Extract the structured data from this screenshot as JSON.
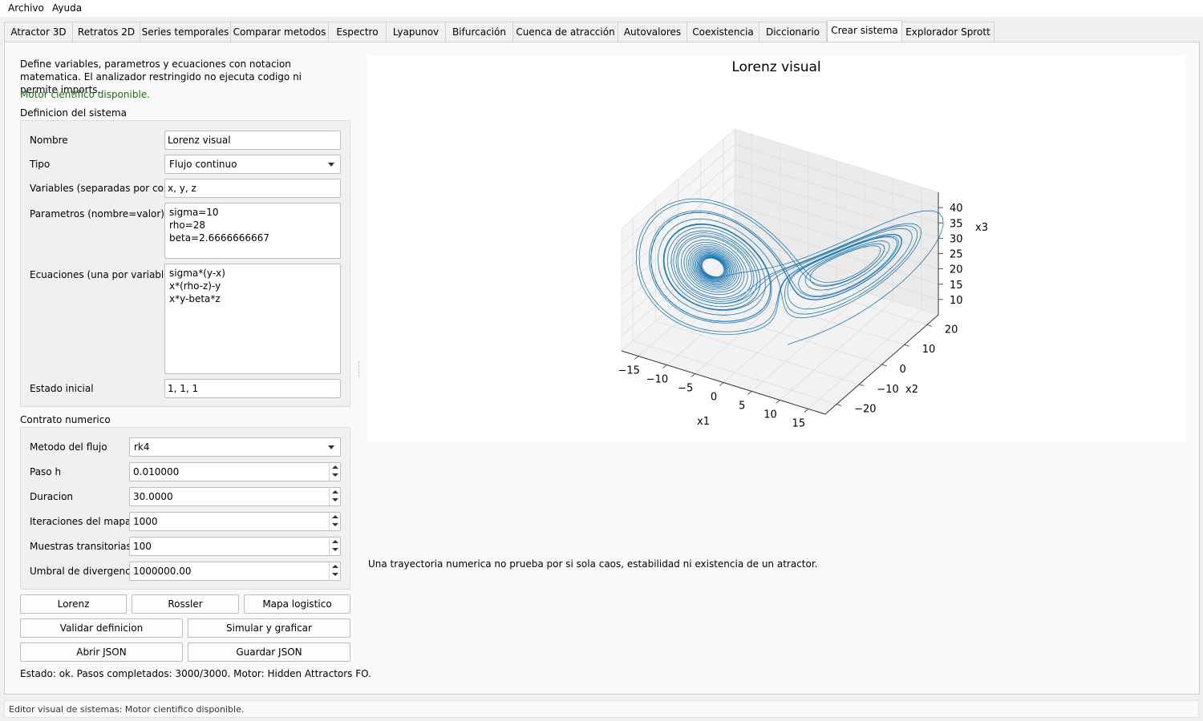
{
  "menu": [
    "Archivo",
    "Ayuda"
  ],
  "tabs": [
    "Atractor 3D",
    "Retratos 2D",
    "Series temporales",
    "Comparar metodos",
    "Espectro",
    "Lyapunov",
    "Bifurcación",
    "Cuenca de atracción",
    "Autovalores",
    "Coexistencia",
    "Diccionario",
    "Crear sistema",
    "Explorador Sprott"
  ],
  "active_tab": "Crear sistema",
  "intro": "Define variables, parametros y ecuaciones con notacion matematica. El analizador restringido no ejecuta codigo ni permite imports.",
  "motor_status": "Motor cientifico disponible.",
  "definition": {
    "section_title": "Definicion del sistema",
    "name_label": "Nombre",
    "name_value": "Lorenz visual",
    "type_label": "Tipo",
    "type_value": "Flujo continuo",
    "variables_label": "Variables (separadas por coma)",
    "variables_value": "x, y, z",
    "params_label": "Parametros (nombre=valor)",
    "params_lines": [
      "sigma=10",
      "rho=28",
      "beta=2.6666666667"
    ],
    "equations_label": "Ecuaciones (una por variable)",
    "equations_lines": [
      "sigma*(y-x)",
      "x*(rho-z)-y",
      "x*y-beta*z"
    ],
    "initial_label": "Estado inicial",
    "initial_value": "1, 1, 1"
  },
  "contract": {
    "section_title": "Contrato numerico",
    "method_label": "Metodo del flujo",
    "method_value": "rk4",
    "step_label": "Paso h",
    "step_value": "0.010000",
    "duration_label": "Duracion",
    "duration_value": "30.0000",
    "iterations_label": "Iteraciones del mapa",
    "iterations_value": "1000",
    "transient_label": "Muestras transitorias",
    "transient_value": "100",
    "threshold_label": "Umbral de divergencia",
    "threshold_value": "1000000.00"
  },
  "buttons": {
    "lorenz": "Lorenz",
    "rossler": "Rossler",
    "logistic": "Mapa logistico",
    "validate": "Validar definicion",
    "simulate": "Simular y graficar",
    "open_json": "Abrir JSON",
    "save_json": "Guardar JSON"
  },
  "run_status": "Estado: ok. Pasos completados: 3000/3000. Motor: Hidden Attractors FO.",
  "note": "Una trayectoria numerica no prueba por si sola caos, estabilidad ni existencia de un atractor.",
  "statusbar": "Editor visual de sistemas: Motor cientifico disponible.",
  "chart_data": {
    "type": "line",
    "projection": "3d",
    "title": "Lorenz visual",
    "xlabel": "x1",
    "ylabel": "x2",
    "zlabel": "x3",
    "x_ticks": [
      "−15",
      "−10",
      "−5",
      "0",
      "5",
      "10",
      "15"
    ],
    "y_ticks": [
      "−20",
      "−10",
      "0",
      "10",
      "20"
    ],
    "z_ticks": [
      "10",
      "15",
      "20",
      "25",
      "30",
      "35",
      "40"
    ],
    "xlim": [
      -18,
      18
    ],
    "ylim": [
      -25,
      25
    ],
    "zlim": [
      5,
      45
    ],
    "series_color": "#1f77b4",
    "system": {
      "sigma": 10,
      "rho": 28,
      "beta": 2.6666666667,
      "x0": [
        1,
        1,
        1
      ],
      "h": 0.01,
      "steps": 3000
    }
  }
}
